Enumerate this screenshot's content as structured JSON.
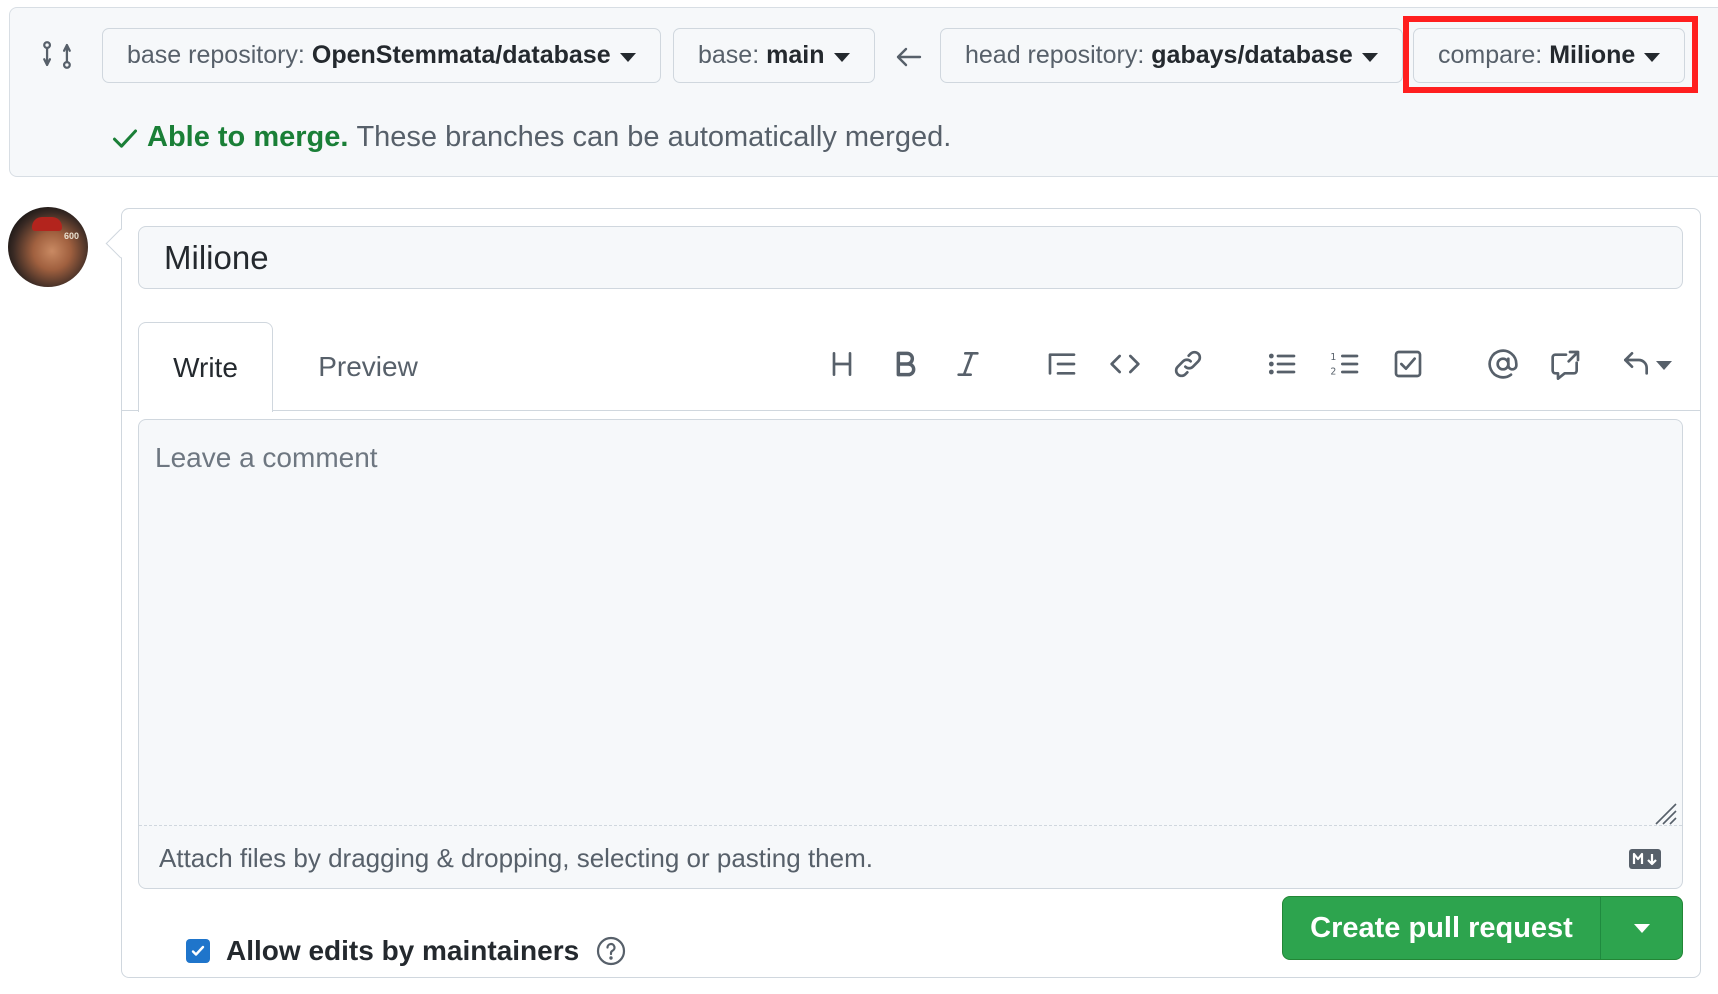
{
  "compare_bar": {
    "base_repository": {
      "label": "base repository:",
      "value": "OpenStemmata/database"
    },
    "base_branch": {
      "label": "base:",
      "value": "main"
    },
    "head_repository": {
      "label": "head repository:",
      "value": "gabays/database"
    },
    "compare_branch": {
      "label": "compare:",
      "value": "Milione"
    },
    "merge_status": {
      "headline": "Able to merge.",
      "description": "These branches can be automatically merged."
    }
  },
  "form": {
    "title_value": "Milione",
    "tabs": [
      {
        "label": "Write",
        "active": true
      },
      {
        "label": "Preview",
        "active": false
      }
    ],
    "toolbar": [
      "heading-icon",
      "bold-icon",
      "italic-icon",
      "quote-icon",
      "code-icon",
      "link-icon",
      "unordered-list-icon",
      "ordered-list-icon",
      "task-list-icon",
      "mention-icon",
      "cross-reference-icon",
      "saved-replies-icon"
    ],
    "comment_placeholder": "Leave a comment",
    "attach_hint": "Attach files by dragging & dropping, selecting or pasting them.",
    "allow_edits_label": "Allow edits by maintainers",
    "allow_edits_checked": true,
    "submit_label": "Create pull request"
  },
  "colors": {
    "success": "#1a7f37",
    "primary_button": "#2da44e",
    "highlight": "#ff1f1f",
    "checkbox": "#1f75cb"
  }
}
